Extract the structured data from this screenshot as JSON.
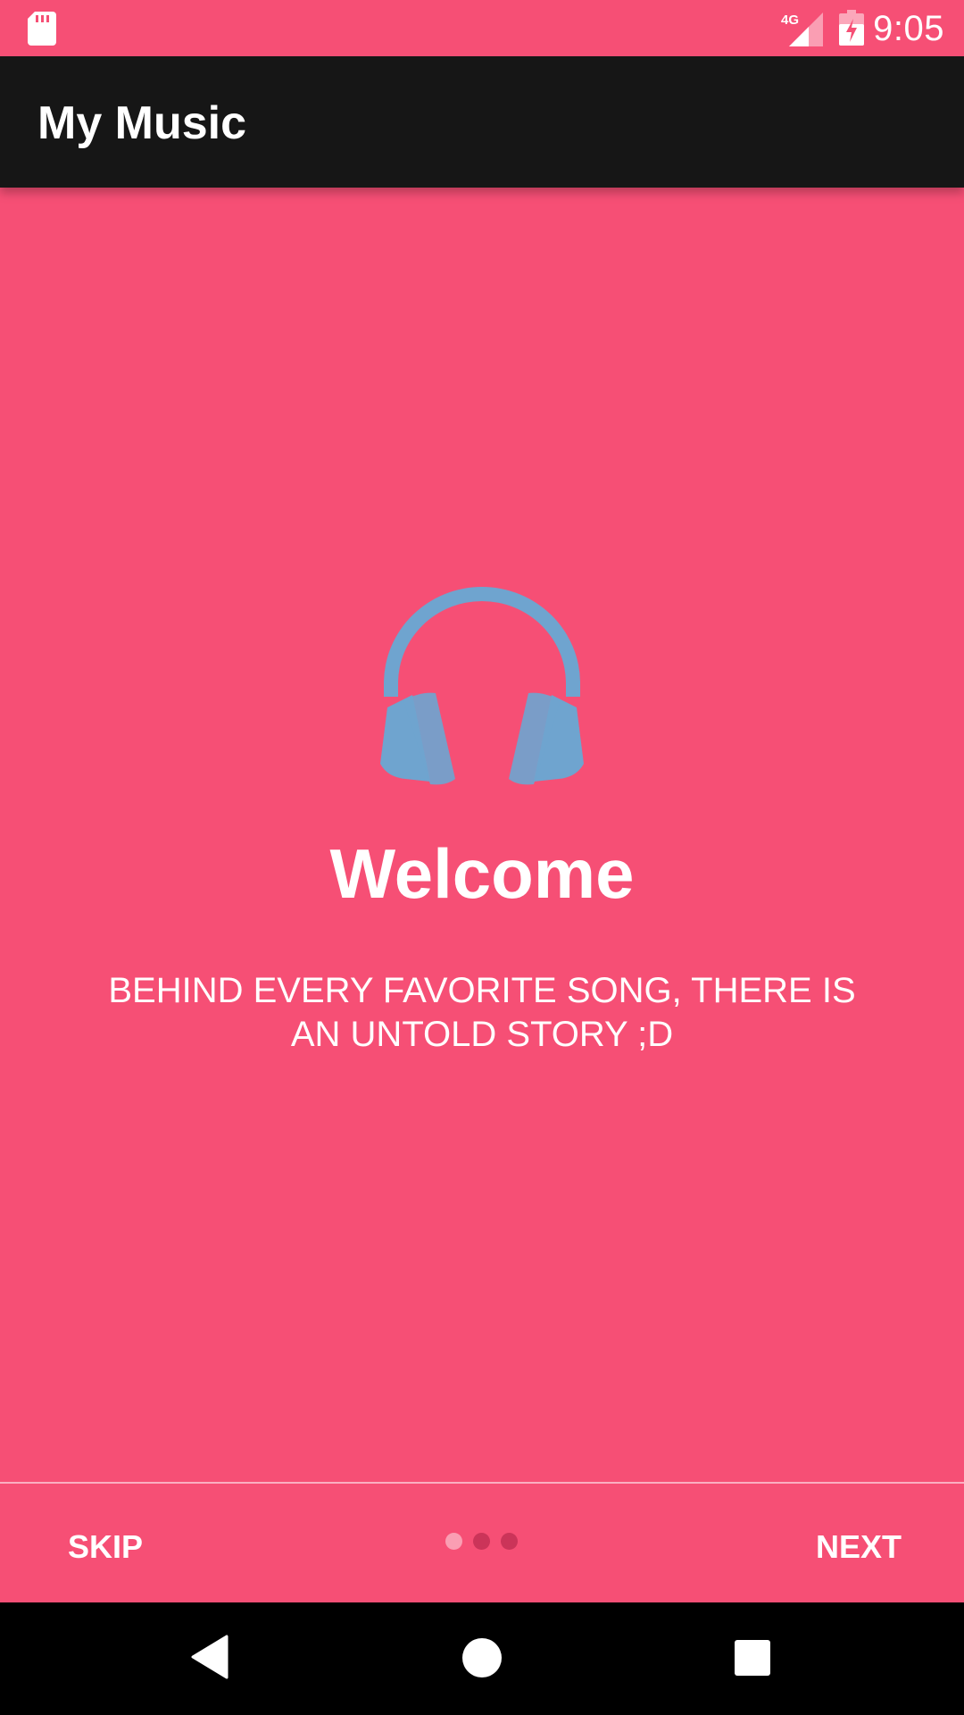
{
  "status_bar": {
    "time": "9:05",
    "network_label": "4G",
    "icons": [
      "sd-card-icon",
      "signal-icon",
      "battery-charging-icon"
    ]
  },
  "app_bar": {
    "title": "My Music"
  },
  "onboarding": {
    "icon": "headphones-icon",
    "title": "Welcome",
    "description": "BEHIND EVERY FAVORITE SONG, THERE IS AN UNTOLD STORY ;D",
    "skip_label": "SKIP",
    "next_label": "NEXT",
    "current_page": 1,
    "page_count": 3
  },
  "nav_bar": {
    "icons": [
      "back-icon",
      "home-icon",
      "recents-icon"
    ]
  },
  "colors": {
    "background": "#f64f75",
    "app_bar": "#161616",
    "icon_accent": "#6fa4cf"
  }
}
